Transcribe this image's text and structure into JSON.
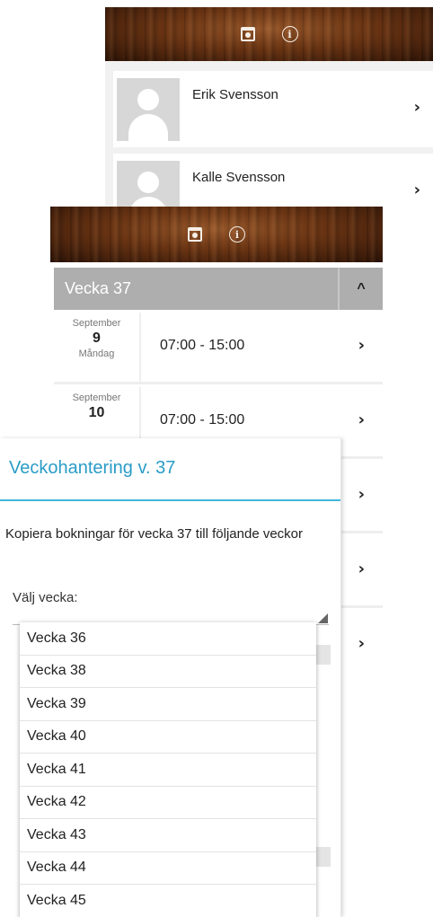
{
  "screen1": {
    "people": [
      {
        "name": "Erik Svensson"
      },
      {
        "name": "Kalle Svensson"
      }
    ]
  },
  "screen2": {
    "week_title": "Vecka 37",
    "collapse_glyph": "^",
    "days": [
      {
        "month": "September",
        "day": "9",
        "weekday": "Måndag",
        "time": "07:00 - 15:00"
      },
      {
        "month": "September",
        "day": "10",
        "weekday": "",
        "time": "07:00 - 15:00"
      }
    ]
  },
  "dialog": {
    "title": "Veckohantering v. 37",
    "text": "Kopiera bokningar för vecka 37 till följande veckor",
    "select_label": "Välj vecka:",
    "options": [
      "Vecka 36",
      "Vecka 38",
      "Vecka 39",
      "Vecka 40",
      "Vecka 41",
      "Vecka 42",
      "Vecka 43",
      "Vecka 44",
      "Vecka 45"
    ]
  },
  "icons": {
    "header": [
      "calendar-icon",
      "info-icon"
    ],
    "row": "chevron-right-icon",
    "avatar": "person-placeholder-icon"
  },
  "colors": {
    "accent": "#2a9cc7",
    "week_header": "#aeaeae",
    "wood": "#6b3514"
  }
}
